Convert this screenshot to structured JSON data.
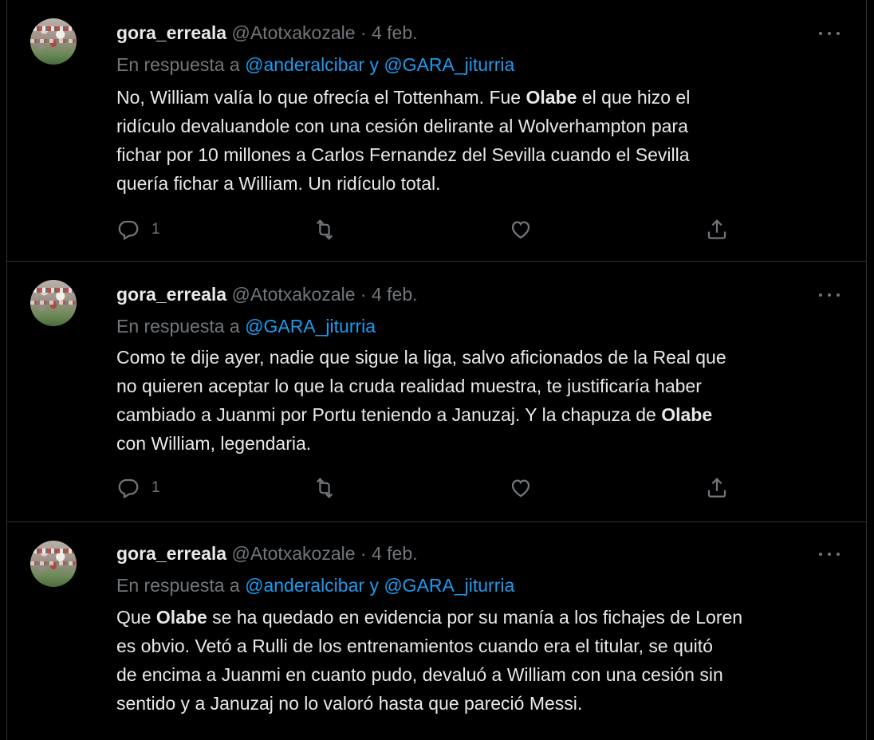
{
  "tweets": [
    {
      "name": "gora_erreala",
      "handle": "@Atotxakozale",
      "separator": "·",
      "date": "4 feb.",
      "reply_prefix": "En respuesta a",
      "mention1": "@anderalcibar",
      "reply_joiner": "y",
      "mention2": "@GARA_jiturria",
      "lines": [
        [
          "No, William valía lo que ofrecía el Tottenham. Fue ",
          "Olabe",
          " el que hizo el"
        ],
        [
          "ridículo devaluandole con una cesión delirante al Wolverhampton para",
          "",
          ""
        ],
        [
          "fichar por 10 millones a Carlos Fernandez del Sevilla cuando el Sevilla",
          "",
          ""
        ],
        [
          "quería fichar a William. Un ridículo total.",
          "",
          ""
        ]
      ],
      "reply_count": "1"
    },
    {
      "name": "gora_erreala",
      "handle": "@Atotxakozale",
      "separator": "·",
      "date": "4 feb.",
      "reply_prefix": "En respuesta a",
      "mention1": "@GARA_jiturria",
      "lines": [
        [
          "Como te dije ayer, nadie que sigue la liga, salvo aficionados de la Real que",
          "",
          ""
        ],
        [
          "no quieren aceptar lo que la cruda realidad muestra, te justificaría haber",
          "",
          ""
        ],
        [
          "cambiado a Juanmi por Portu teniendo a Januzaj. Y la chapuza de ",
          "Olabe",
          ""
        ],
        [
          "con William, legendaria.",
          "",
          ""
        ]
      ],
      "reply_count": "1"
    },
    {
      "name": "gora_erreala",
      "handle": "@Atotxakozale",
      "separator": "·",
      "date": "4 feb.",
      "reply_prefix": "En respuesta a",
      "mention1": "@anderalcibar",
      "reply_joiner": "y",
      "mention2": "@GARA_jiturria",
      "lines": [
        [
          "Que ",
          "Olabe",
          " se ha quedado en evidencia por su manía a los fichajes de Loren"
        ],
        [
          "es obvio. Vetó a Rulli de los entrenamientos cuando era el titular, se quitó",
          "",
          ""
        ],
        [
          "de encima a Juanmi en cuanto pudo, devaluó a William con una cesión sin",
          "",
          ""
        ],
        [
          "sentido y a Januzaj no lo valoró hasta que pareció Messi.",
          "",
          ""
        ]
      ]
    }
  ],
  "icons": {
    "reply": "reply-icon",
    "retweet": "retweet-icon",
    "like": "like-icon",
    "share": "share-icon",
    "more": "more-icon"
  },
  "colors": {
    "background": "#000000",
    "text": "#e7e9ea",
    "secondary": "#71767b",
    "link": "#1d9bf0",
    "divider": "#2f3336"
  }
}
